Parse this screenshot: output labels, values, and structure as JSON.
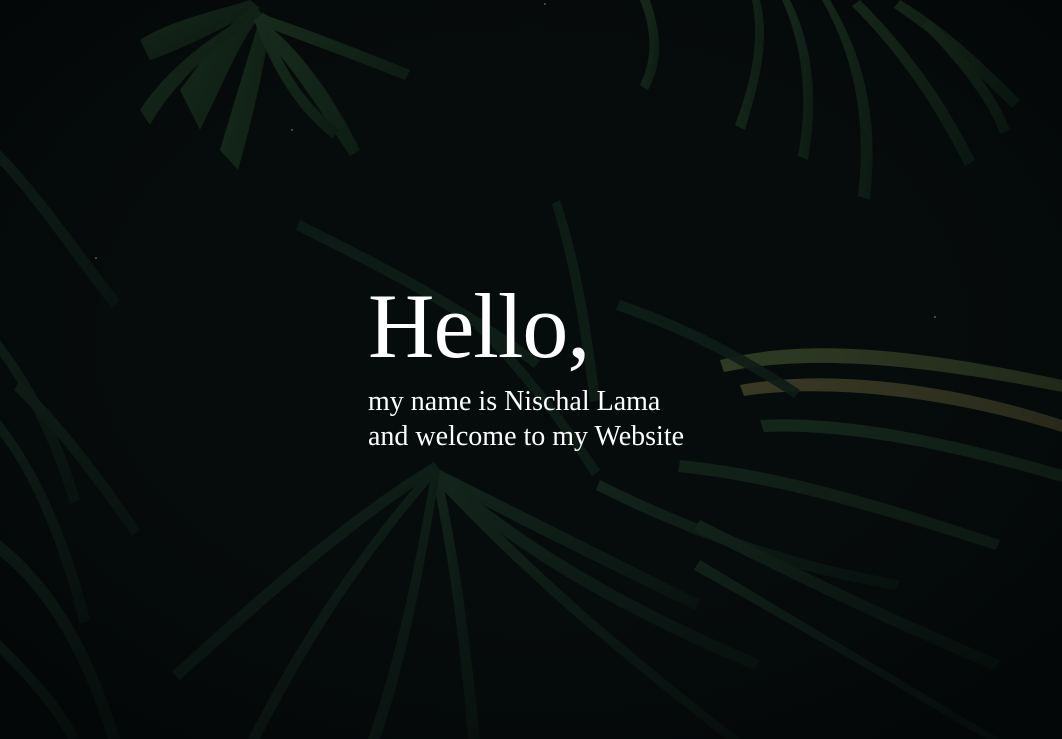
{
  "hero": {
    "greeting": "Hello,",
    "line1": "my name is Nischal Lama",
    "line2": "and welcome to my Website"
  },
  "background": {
    "description_icon": "palm-leaves-photo",
    "base_color": "#060b0c",
    "leaf_color": "#1c3a25"
  }
}
